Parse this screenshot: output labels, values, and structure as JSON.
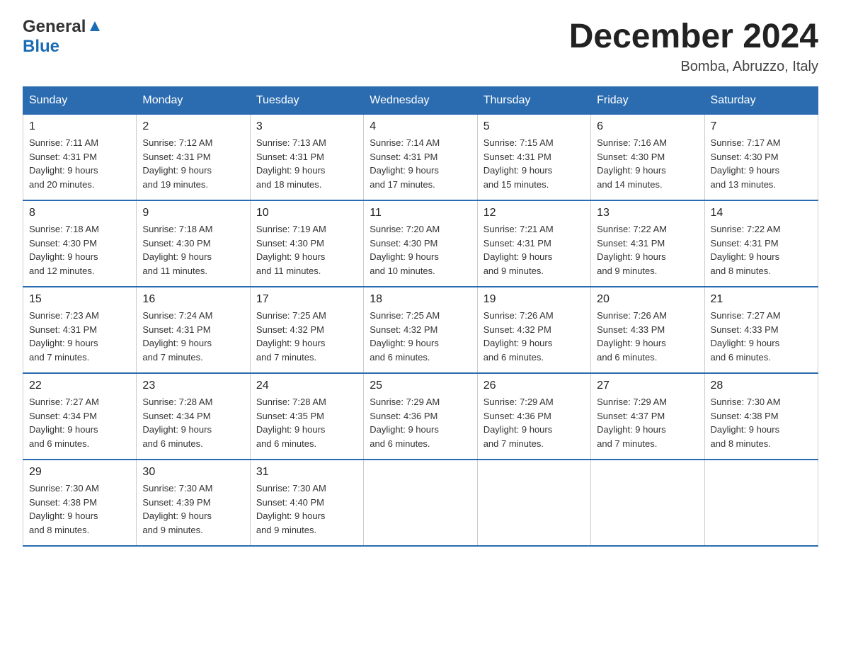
{
  "logo": {
    "general": "General",
    "blue": "Blue",
    "triangle": "▲"
  },
  "title": "December 2024",
  "subtitle": "Bomba, Abruzzo, Italy",
  "headers": [
    "Sunday",
    "Monday",
    "Tuesday",
    "Wednesday",
    "Thursday",
    "Friday",
    "Saturday"
  ],
  "weeks": [
    [
      {
        "day": "1",
        "sunrise": "7:11 AM",
        "sunset": "4:31 PM",
        "daylight": "9 hours and 20 minutes."
      },
      {
        "day": "2",
        "sunrise": "7:12 AM",
        "sunset": "4:31 PM",
        "daylight": "9 hours and 19 minutes."
      },
      {
        "day": "3",
        "sunrise": "7:13 AM",
        "sunset": "4:31 PM",
        "daylight": "9 hours and 18 minutes."
      },
      {
        "day": "4",
        "sunrise": "7:14 AM",
        "sunset": "4:31 PM",
        "daylight": "9 hours and 17 minutes."
      },
      {
        "day": "5",
        "sunrise": "7:15 AM",
        "sunset": "4:31 PM",
        "daylight": "9 hours and 15 minutes."
      },
      {
        "day": "6",
        "sunrise": "7:16 AM",
        "sunset": "4:30 PM",
        "daylight": "9 hours and 14 minutes."
      },
      {
        "day": "7",
        "sunrise": "7:17 AM",
        "sunset": "4:30 PM",
        "daylight": "9 hours and 13 minutes."
      }
    ],
    [
      {
        "day": "8",
        "sunrise": "7:18 AM",
        "sunset": "4:30 PM",
        "daylight": "9 hours and 12 minutes."
      },
      {
        "day": "9",
        "sunrise": "7:18 AM",
        "sunset": "4:30 PM",
        "daylight": "9 hours and 11 minutes."
      },
      {
        "day": "10",
        "sunrise": "7:19 AM",
        "sunset": "4:30 PM",
        "daylight": "9 hours and 11 minutes."
      },
      {
        "day": "11",
        "sunrise": "7:20 AM",
        "sunset": "4:30 PM",
        "daylight": "9 hours and 10 minutes."
      },
      {
        "day": "12",
        "sunrise": "7:21 AM",
        "sunset": "4:31 PM",
        "daylight": "9 hours and 9 minutes."
      },
      {
        "day": "13",
        "sunrise": "7:22 AM",
        "sunset": "4:31 PM",
        "daylight": "9 hours and 9 minutes."
      },
      {
        "day": "14",
        "sunrise": "7:22 AM",
        "sunset": "4:31 PM",
        "daylight": "9 hours and 8 minutes."
      }
    ],
    [
      {
        "day": "15",
        "sunrise": "7:23 AM",
        "sunset": "4:31 PM",
        "daylight": "9 hours and 7 minutes."
      },
      {
        "day": "16",
        "sunrise": "7:24 AM",
        "sunset": "4:31 PM",
        "daylight": "9 hours and 7 minutes."
      },
      {
        "day": "17",
        "sunrise": "7:25 AM",
        "sunset": "4:32 PM",
        "daylight": "9 hours and 7 minutes."
      },
      {
        "day": "18",
        "sunrise": "7:25 AM",
        "sunset": "4:32 PM",
        "daylight": "9 hours and 6 minutes."
      },
      {
        "day": "19",
        "sunrise": "7:26 AM",
        "sunset": "4:32 PM",
        "daylight": "9 hours and 6 minutes."
      },
      {
        "day": "20",
        "sunrise": "7:26 AM",
        "sunset": "4:33 PM",
        "daylight": "9 hours and 6 minutes."
      },
      {
        "day": "21",
        "sunrise": "7:27 AM",
        "sunset": "4:33 PM",
        "daylight": "9 hours and 6 minutes."
      }
    ],
    [
      {
        "day": "22",
        "sunrise": "7:27 AM",
        "sunset": "4:34 PM",
        "daylight": "9 hours and 6 minutes."
      },
      {
        "day": "23",
        "sunrise": "7:28 AM",
        "sunset": "4:34 PM",
        "daylight": "9 hours and 6 minutes."
      },
      {
        "day": "24",
        "sunrise": "7:28 AM",
        "sunset": "4:35 PM",
        "daylight": "9 hours and 6 minutes."
      },
      {
        "day": "25",
        "sunrise": "7:29 AM",
        "sunset": "4:36 PM",
        "daylight": "9 hours and 6 minutes."
      },
      {
        "day": "26",
        "sunrise": "7:29 AM",
        "sunset": "4:36 PM",
        "daylight": "9 hours and 7 minutes."
      },
      {
        "day": "27",
        "sunrise": "7:29 AM",
        "sunset": "4:37 PM",
        "daylight": "9 hours and 7 minutes."
      },
      {
        "day": "28",
        "sunrise": "7:30 AM",
        "sunset": "4:38 PM",
        "daylight": "9 hours and 8 minutes."
      }
    ],
    [
      {
        "day": "29",
        "sunrise": "7:30 AM",
        "sunset": "4:38 PM",
        "daylight": "9 hours and 8 minutes."
      },
      {
        "day": "30",
        "sunrise": "7:30 AM",
        "sunset": "4:39 PM",
        "daylight": "9 hours and 9 minutes."
      },
      {
        "day": "31",
        "sunrise": "7:30 AM",
        "sunset": "4:40 PM",
        "daylight": "9 hours and 9 minutes."
      },
      null,
      null,
      null,
      null
    ]
  ],
  "labels": {
    "sunrise": "Sunrise:",
    "sunset": "Sunset:",
    "daylight": "Daylight:"
  }
}
